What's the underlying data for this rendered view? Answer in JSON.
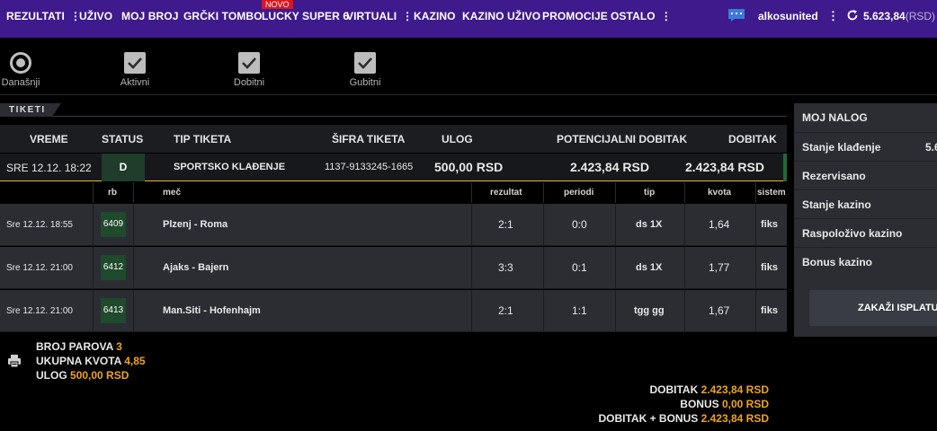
{
  "nav": {
    "items": [
      {
        "label": "REZULTATI",
        "kebab": "⋮"
      },
      {
        "label": "UŽIVO"
      },
      {
        "label": "MOJ BROJ"
      },
      {
        "label": "GRČKI TOMBO"
      },
      {
        "label": "LUCKY SUPER 6"
      },
      {
        "label": "VIRTUALI",
        "kebab": "⋮"
      },
      {
        "label": "KAZINO"
      },
      {
        "label": "KAZINO UŽIVO"
      },
      {
        "label": "PROMOCIJE"
      },
      {
        "label": "OSTALO",
        "kebab": "⋮"
      }
    ],
    "badge": "NOVO",
    "username": "alkosunited",
    "user_kebab": "⋮",
    "balance": "5.623,84",
    "balance_currency": "(RSD)"
  },
  "filters": [
    {
      "label": "Današnji",
      "type": "radio"
    },
    {
      "label": "Aktivni",
      "type": "check"
    },
    {
      "label": "Dobitni",
      "type": "check"
    },
    {
      "label": "Gubitni",
      "type": "check"
    }
  ],
  "tab": {
    "label": "TIKETI"
  },
  "ticket_table": {
    "headers": {
      "vreme": "VREME",
      "status": "STATUS",
      "tip": "TIP TIKETA",
      "sifra": "ŠIFRA TIKETA",
      "ulog": "ULOG",
      "potencijalni": "POTENCIJALNI DOBITAK",
      "dobitak": "DOBITAK"
    },
    "row": {
      "vreme": "SRE 12.12. 18:22",
      "status": "D",
      "tip": "SPORTSKO KLAĐENJE",
      "sifra": "1137-9133245-1665",
      "ulog": "500,00 RSD",
      "potencijalni": "2.423,84 RSD",
      "dobitak": "2.423,84 RSD"
    }
  },
  "match_table": {
    "headers": {
      "rb": "rb",
      "mec": "meč",
      "rezultat": "rezultat",
      "periodi": "periodi",
      "tip": "tip",
      "kvota": "kvota",
      "sistem": "sistem"
    },
    "rows": [
      {
        "time": "Sre 12.12. 18:55",
        "rb": "6409",
        "match": "Plzenj - Roma",
        "rezultat": "2:1",
        "periodi": "0:0",
        "tip": "ds 1X",
        "kvota": "1,64",
        "sistem": "fiks"
      },
      {
        "time": "Sre 12.12. 21:00",
        "rb": "6412",
        "match": "Ajaks - Bajern",
        "rezultat": "3:3",
        "periodi": "0:1",
        "tip": "ds 1X",
        "kvota": "1,77",
        "sistem": "fiks"
      },
      {
        "time": "Sre 12.12. 21:00",
        "rb": "6413",
        "match": "Man.Siti - Hofenhajm",
        "rezultat": "2:1",
        "periodi": "1:1",
        "tip": "tgg gg",
        "kvota": "1,67",
        "sistem": "fiks"
      }
    ]
  },
  "summary": {
    "broj_parova_label": "BROJ PAROVA",
    "broj_parova": "3",
    "ukupna_kvota_label": "UKUPNA KVOTA",
    "ukupna_kvota": "4,85",
    "ulog_label": "ULOG",
    "ulog": "500,00 RSD",
    "dobitak_label": "DOBITAK",
    "dobitak": "2.423,84 RSD",
    "bonus_label": "BONUS",
    "bonus": "0,00 RSD",
    "dobitak_bonus_label": "DOBITAK + BONUS",
    "dobitak_bonus": "2.423,84 RSD"
  },
  "account": {
    "title": "MOJ NALOG",
    "rows": [
      {
        "label": "Stanje klađenje",
        "value": "5.6"
      },
      {
        "label": "Rezervisano"
      },
      {
        "label": "Stanje kazino"
      },
      {
        "label": "Raspoloživo kazino"
      },
      {
        "label": "Bonus kazino"
      }
    ],
    "button": "ZAKAŽI ISPLATU"
  },
  "colors": {
    "nav_bg": "#3e1a8c",
    "accent_orange": "#f0a41c",
    "accent_yellow_line": "#e8b82e",
    "status_green": "#1f3d2a"
  }
}
